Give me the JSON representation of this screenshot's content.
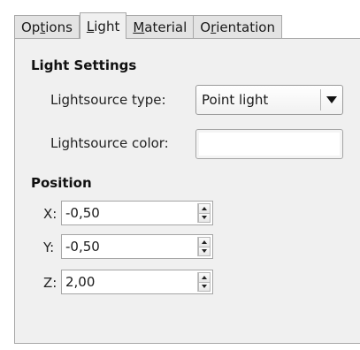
{
  "tabs": {
    "options": {
      "pre": "Op",
      "u": "t",
      "post": "ions"
    },
    "light": {
      "pre": "",
      "u": "L",
      "post": "ight"
    },
    "material": {
      "pre": "",
      "u": "M",
      "post": "aterial"
    },
    "orientation": {
      "pre": "O",
      "u": "r",
      "post": "ientation"
    },
    "active": "Light"
  },
  "light_settings": {
    "title": "Light Settings",
    "type_label": "Lightsource type:",
    "type_value": "Point light",
    "color_label": "Lightsource color:",
    "color_value": "#ffffff"
  },
  "position": {
    "title": "Position",
    "x_label": "X:",
    "x_value": "-0,50",
    "y_label": "Y:",
    "y_value": "-0,50",
    "z_label": "Z:",
    "z_value": "2,00"
  },
  "icons": {
    "dropdown": "triangle-down",
    "spin_up": "triangle-up",
    "spin_down": "triangle-down"
  }
}
